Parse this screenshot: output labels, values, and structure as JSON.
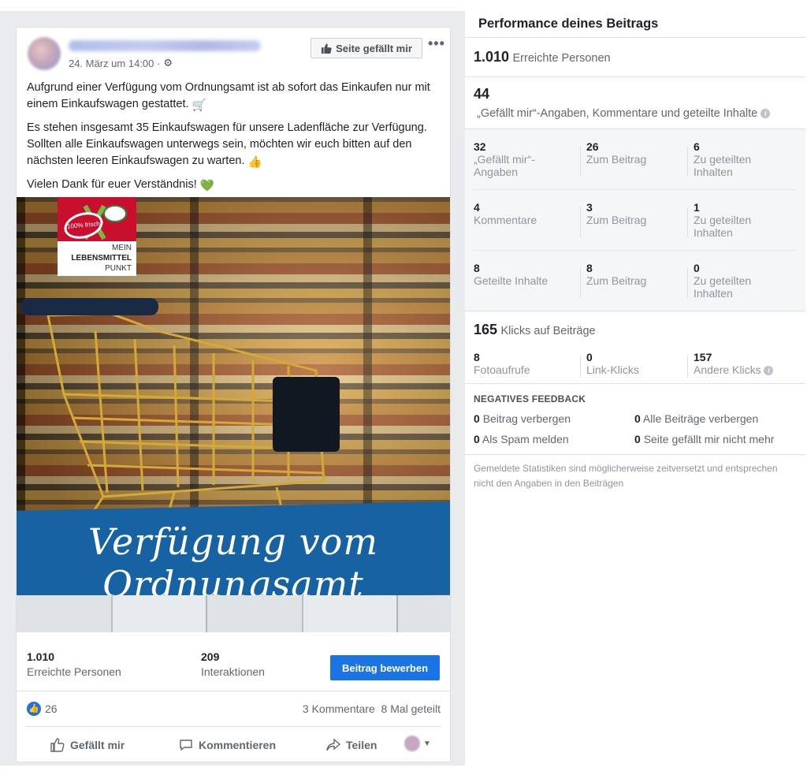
{
  "post": {
    "date": "24. März um 14:00 ·",
    "like_page_label": "Seite gefällt mir",
    "paragraphs": [
      "Aufgrund einer Verfügung vom Ordnungsamt ist ab sofort das Einkaufen nur mit einem Einkaufswagen gestattet.",
      "Es stehen insgesamt 35 Einkaufswagen für unsere Ladenfläche zur Verfügung. Sollten alle Einkaufswagen unterwegs sein, möchten wir euch bitten auf den nächsten leeren Einkaufswagen zu warten.",
      "Vielen Dank für euer Verständnis!"
    ],
    "emojis": [
      "🛒",
      "👍",
      "💚"
    ],
    "image": {
      "logo_line1": "MEIN",
      "logo_line2": "LEBENSMITTEL",
      "logo_line3": "PUNKT",
      "logo_badge": "100% frisch",
      "banner_text": "Verfügung vom Ordnungsamt"
    },
    "stats": {
      "reach_value": "1.010",
      "reach_label": "Erreichte Personen",
      "interactions_value": "209",
      "interactions_label": "Interaktionen",
      "boost_label": "Beitrag bewerben"
    },
    "reactions": {
      "count": "26",
      "comments": "3 Kommentare",
      "shares": "8 Mal geteilt"
    },
    "actions": {
      "like": "Gefällt mir",
      "comment": "Kommentieren",
      "share": "Teilen"
    }
  },
  "performance": {
    "title": "Performance deines Beitrags",
    "reach": {
      "value": "1.010",
      "label": "Erreichte Personen"
    },
    "engagement": {
      "value": "44",
      "label": "„Gefällt mir“-Angaben, Kommentare und geteilte Inhalte"
    },
    "rows": [
      {
        "c1n": "32",
        "c1t": "„Gefällt mir“-Angaben",
        "c2n": "26",
        "c2t": "Zum Beitrag",
        "c3n": "6",
        "c3t": "Zu geteilten Inhalten"
      },
      {
        "c1n": "4",
        "c1t": "Kommentare",
        "c2n": "3",
        "c2t": "Zum Beitrag",
        "c3n": "1",
        "c3t": "Zu geteilten Inhalten"
      },
      {
        "c1n": "8",
        "c1t": "Geteilte Inhalte",
        "c2n": "8",
        "c2t": "Zum Beitrag",
        "c3n": "0",
        "c3t": "Zu geteilten Inhalten"
      }
    ],
    "clicks": {
      "value": "165",
      "label": "Klicks auf Beiträge"
    },
    "click_rows": [
      {
        "n": "8",
        "t": "Fotoaufrufe"
      },
      {
        "n": "0",
        "t": "Link-Klicks"
      },
      {
        "n": "157",
        "t": "Andere Klicks"
      }
    ],
    "negative": {
      "title": "NEGATIVES FEEDBACK",
      "items": [
        {
          "n": "0",
          "t": "Beitrag verbergen"
        },
        {
          "n": "0",
          "t": "Alle Beiträge verbergen"
        },
        {
          "n": "0",
          "t": "Als Spam melden"
        },
        {
          "n": "0",
          "t": "Seite gefällt mir nicht mehr"
        }
      ]
    },
    "footnote": "Gemeldete Statistiken sind möglicherweise zeitversetzt und entsprechen nicht den Angaben in den Beiträgen",
    "info_glyph": "i"
  },
  "colors": {
    "accent": "#1b74e4",
    "banner": "#1662a3",
    "logo_red": "#c8102e"
  }
}
